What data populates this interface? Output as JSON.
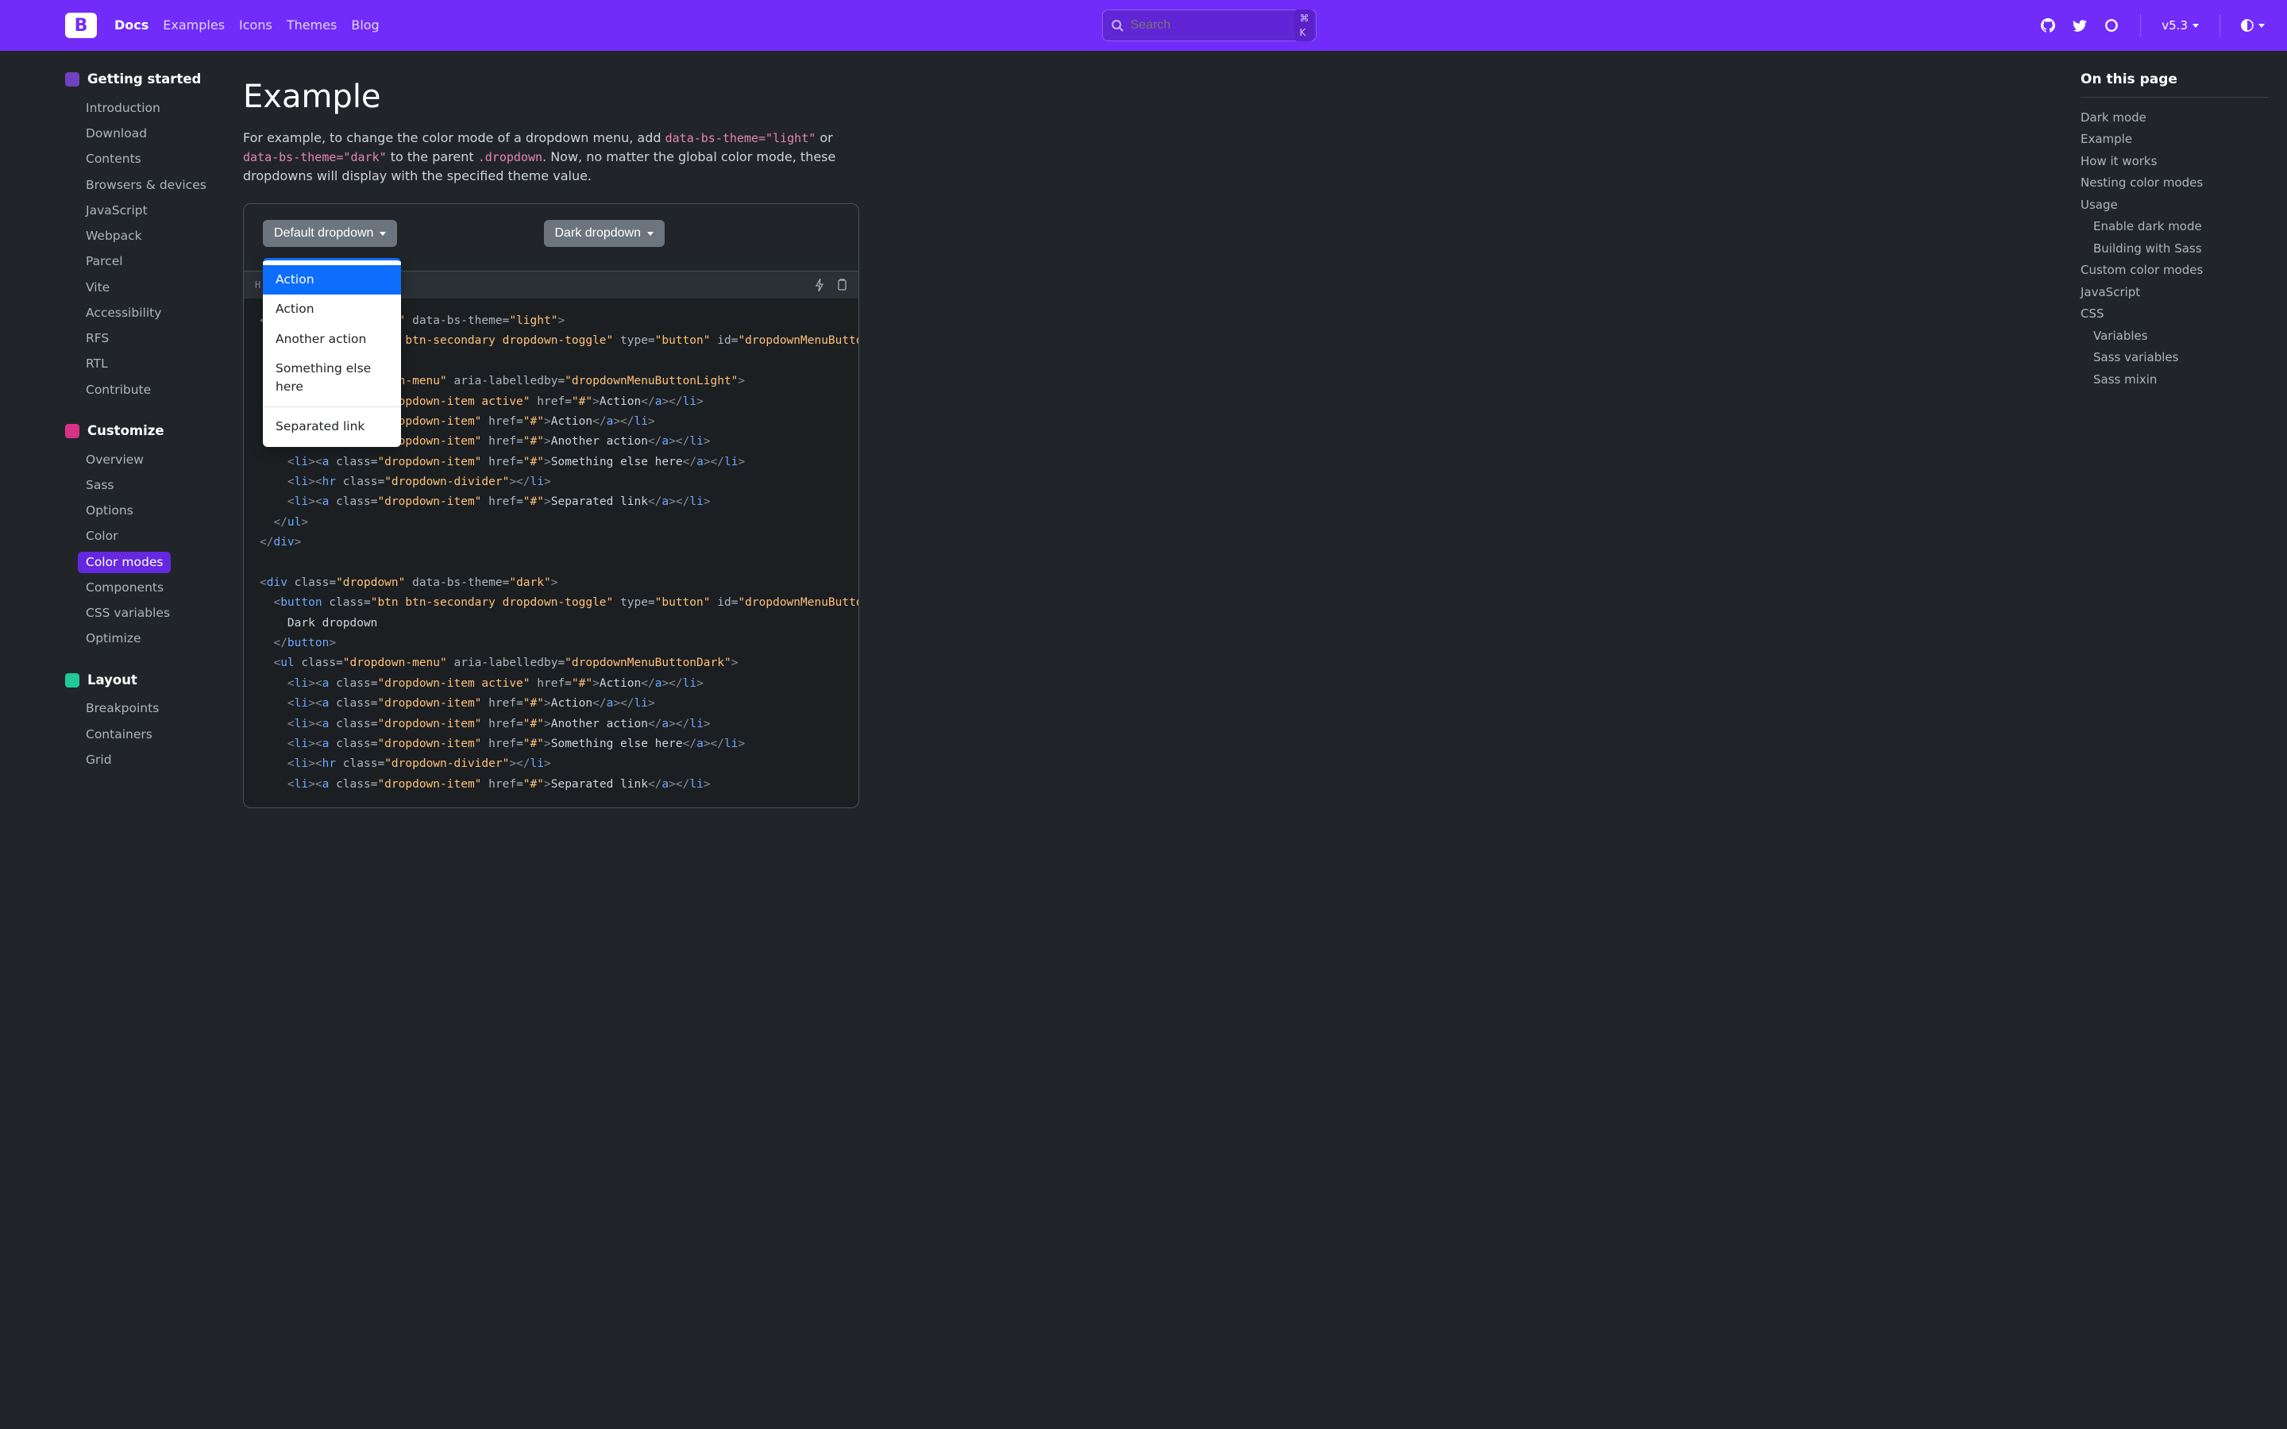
{
  "header": {
    "nav": [
      "Docs",
      "Examples",
      "Icons",
      "Themes",
      "Blog"
    ],
    "nav_active": 0,
    "search_placeholder": "Search",
    "search_kbd": "⌘ K",
    "version": "v5.3"
  },
  "sidebar": {
    "sections": [
      {
        "title": "Getting started",
        "badge": "violet",
        "items": [
          "Introduction",
          "Download",
          "Contents",
          "Browsers & devices",
          "JavaScript",
          "Webpack",
          "Parcel",
          "Vite",
          "Accessibility",
          "RFS",
          "RTL",
          "Contribute"
        ],
        "active": -1
      },
      {
        "title": "Customize",
        "badge": "pink",
        "items": [
          "Overview",
          "Sass",
          "Options",
          "Color",
          "Color modes",
          "Components",
          "CSS variables",
          "Optimize"
        ],
        "active": 4
      },
      {
        "title": "Layout",
        "badge": "teal",
        "items": [
          "Breakpoints",
          "Containers",
          "Grid"
        ],
        "active": -1
      }
    ]
  },
  "main": {
    "title": "Example",
    "lead_pre": "For example, to change the color mode of a dropdown menu, add ",
    "code1": "data-bs-theme=\"light\"",
    "lead_mid": " or ",
    "code2": "data-bs-theme=\"dark\"",
    "lead_mid2": " to the parent ",
    "code3": ".dropdown",
    "lead_post": ". Now, no matter the global color mode, these dropdowns will display with the specified theme value.",
    "btn_default": "Default dropdown",
    "btn_dark": "Dark dropdown",
    "dropdown_items": [
      "Action",
      "Action",
      "Another action",
      "Something else here",
      "Separated link"
    ],
    "code_label": "H"
  },
  "toc": {
    "title": "On this page",
    "items": [
      {
        "label": "Dark mode",
        "sub": false
      },
      {
        "label": "Example",
        "sub": false
      },
      {
        "label": "How it works",
        "sub": false
      },
      {
        "label": "Nesting color modes",
        "sub": false
      },
      {
        "label": "Usage",
        "sub": false
      },
      {
        "label": "Enable dark mode",
        "sub": true
      },
      {
        "label": "Building with Sass",
        "sub": true
      },
      {
        "label": "Custom color modes",
        "sub": false
      },
      {
        "label": "JavaScript",
        "sub": false
      },
      {
        "label": "CSS",
        "sub": false
      },
      {
        "label": "Variables",
        "sub": true
      },
      {
        "label": "Sass variables",
        "sub": true
      },
      {
        "label": "Sass mixin",
        "sub": true
      }
    ]
  },
  "code_lines": [
    [
      {
        "c": "p",
        "t": "<"
      },
      {
        "c": "t",
        "t": "div"
      },
      {
        "c": "p",
        "t": " "
      },
      {
        "c": "an",
        "t": "class"
      },
      {
        "c": "eq",
        "t": "="
      },
      {
        "c": "av",
        "t": "\"dropdown\""
      },
      {
        "c": "p",
        "t": " "
      },
      {
        "c": "an",
        "t": "data-bs-theme"
      },
      {
        "c": "eq",
        "t": "="
      },
      {
        "c": "av",
        "t": "\"light\""
      },
      {
        "c": "p",
        "t": ">"
      }
    ],
    [
      {
        "c": "p",
        "t": "  <"
      },
      {
        "c": "t",
        "t": "button"
      },
      {
        "c": "p",
        "t": " "
      },
      {
        "c": "an",
        "t": "class"
      },
      {
        "c": "eq",
        "t": "="
      },
      {
        "c": "av",
        "t": "\"btn btn-secondary dropdown-toggle\""
      },
      {
        "c": "p",
        "t": " "
      },
      {
        "c": "an",
        "t": "type"
      },
      {
        "c": "eq",
        "t": "="
      },
      {
        "c": "av",
        "t": "\"button\""
      },
      {
        "c": "p",
        "t": " "
      },
      {
        "c": "an",
        "t": "id"
      },
      {
        "c": "eq",
        "t": "="
      },
      {
        "c": "av",
        "t": "\"dropdownMenuButto"
      }
    ],
    [
      {
        "c": "tx",
        "t": " "
      }
    ],
    [
      {
        "c": "p",
        "t": "  <"
      },
      {
        "c": "t",
        "t": "ul"
      },
      {
        "c": "p",
        "t": " "
      },
      {
        "c": "an",
        "t": "class"
      },
      {
        "c": "eq",
        "t": "="
      },
      {
        "c": "av",
        "t": "\"dropdown-menu\""
      },
      {
        "c": "p",
        "t": " "
      },
      {
        "c": "an",
        "t": "aria-labelledby"
      },
      {
        "c": "eq",
        "t": "="
      },
      {
        "c": "av",
        "t": "\"dropdownMenuButtonLight\""
      },
      {
        "c": "p",
        "t": ">"
      }
    ],
    [
      {
        "c": "p",
        "t": "    <"
      },
      {
        "c": "t",
        "t": "li"
      },
      {
        "c": "p",
        "t": "><"
      },
      {
        "c": "t",
        "t": "a"
      },
      {
        "c": "p",
        "t": " "
      },
      {
        "c": "an",
        "t": "class"
      },
      {
        "c": "eq",
        "t": "="
      },
      {
        "c": "av",
        "t": "\"dropdown-item active\""
      },
      {
        "c": "p",
        "t": " "
      },
      {
        "c": "an",
        "t": "href"
      },
      {
        "c": "eq",
        "t": "="
      },
      {
        "c": "av",
        "t": "\"#\""
      },
      {
        "c": "p",
        "t": ">"
      },
      {
        "c": "tx",
        "t": "Action"
      },
      {
        "c": "p",
        "t": "</"
      },
      {
        "c": "t",
        "t": "a"
      },
      {
        "c": "p",
        "t": "></"
      },
      {
        "c": "t",
        "t": "li"
      },
      {
        "c": "p",
        "t": ">"
      }
    ],
    [
      {
        "c": "p",
        "t": "    <"
      },
      {
        "c": "t",
        "t": "li"
      },
      {
        "c": "p",
        "t": "><"
      },
      {
        "c": "t",
        "t": "a"
      },
      {
        "c": "p",
        "t": " "
      },
      {
        "c": "an",
        "t": "class"
      },
      {
        "c": "eq",
        "t": "="
      },
      {
        "c": "av",
        "t": "\"dropdown-item\""
      },
      {
        "c": "p",
        "t": " "
      },
      {
        "c": "an",
        "t": "href"
      },
      {
        "c": "eq",
        "t": "="
      },
      {
        "c": "av",
        "t": "\"#\""
      },
      {
        "c": "p",
        "t": ">"
      },
      {
        "c": "tx",
        "t": "Action"
      },
      {
        "c": "p",
        "t": "</"
      },
      {
        "c": "t",
        "t": "a"
      },
      {
        "c": "p",
        "t": "></"
      },
      {
        "c": "t",
        "t": "li"
      },
      {
        "c": "p",
        "t": ">"
      }
    ],
    [
      {
        "c": "p",
        "t": "    <"
      },
      {
        "c": "t",
        "t": "li"
      },
      {
        "c": "p",
        "t": "><"
      },
      {
        "c": "t",
        "t": "a"
      },
      {
        "c": "p",
        "t": " "
      },
      {
        "c": "an",
        "t": "class"
      },
      {
        "c": "eq",
        "t": "="
      },
      {
        "c": "av",
        "t": "\"dropdown-item\""
      },
      {
        "c": "p",
        "t": " "
      },
      {
        "c": "an",
        "t": "href"
      },
      {
        "c": "eq",
        "t": "="
      },
      {
        "c": "av",
        "t": "\"#\""
      },
      {
        "c": "p",
        "t": ">"
      },
      {
        "c": "tx",
        "t": "Another action"
      },
      {
        "c": "p",
        "t": "</"
      },
      {
        "c": "t",
        "t": "a"
      },
      {
        "c": "p",
        "t": "></"
      },
      {
        "c": "t",
        "t": "li"
      },
      {
        "c": "p",
        "t": ">"
      }
    ],
    [
      {
        "c": "p",
        "t": "    <"
      },
      {
        "c": "t",
        "t": "li"
      },
      {
        "c": "p",
        "t": "><"
      },
      {
        "c": "t",
        "t": "a"
      },
      {
        "c": "p",
        "t": " "
      },
      {
        "c": "an",
        "t": "class"
      },
      {
        "c": "eq",
        "t": "="
      },
      {
        "c": "av",
        "t": "\"dropdown-item\""
      },
      {
        "c": "p",
        "t": " "
      },
      {
        "c": "an",
        "t": "href"
      },
      {
        "c": "eq",
        "t": "="
      },
      {
        "c": "av",
        "t": "\"#\""
      },
      {
        "c": "p",
        "t": ">"
      },
      {
        "c": "tx",
        "t": "Something else here"
      },
      {
        "c": "p",
        "t": "</"
      },
      {
        "c": "t",
        "t": "a"
      },
      {
        "c": "p",
        "t": "></"
      },
      {
        "c": "t",
        "t": "li"
      },
      {
        "c": "p",
        "t": ">"
      }
    ],
    [
      {
        "c": "p",
        "t": "    <"
      },
      {
        "c": "t",
        "t": "li"
      },
      {
        "c": "p",
        "t": "><"
      },
      {
        "c": "t",
        "t": "hr"
      },
      {
        "c": "p",
        "t": " "
      },
      {
        "c": "an",
        "t": "class"
      },
      {
        "c": "eq",
        "t": "="
      },
      {
        "c": "av",
        "t": "\"dropdown-divider\""
      },
      {
        "c": "p",
        "t": "></"
      },
      {
        "c": "t",
        "t": "li"
      },
      {
        "c": "p",
        "t": ">"
      }
    ],
    [
      {
        "c": "p",
        "t": "    <"
      },
      {
        "c": "t",
        "t": "li"
      },
      {
        "c": "p",
        "t": "><"
      },
      {
        "c": "t",
        "t": "a"
      },
      {
        "c": "p",
        "t": " "
      },
      {
        "c": "an",
        "t": "class"
      },
      {
        "c": "eq",
        "t": "="
      },
      {
        "c": "av",
        "t": "\"dropdown-item\""
      },
      {
        "c": "p",
        "t": " "
      },
      {
        "c": "an",
        "t": "href"
      },
      {
        "c": "eq",
        "t": "="
      },
      {
        "c": "av",
        "t": "\"#\""
      },
      {
        "c": "p",
        "t": ">"
      },
      {
        "c": "tx",
        "t": "Separated link"
      },
      {
        "c": "p",
        "t": "</"
      },
      {
        "c": "t",
        "t": "a"
      },
      {
        "c": "p",
        "t": "></"
      },
      {
        "c": "t",
        "t": "li"
      },
      {
        "c": "p",
        "t": ">"
      }
    ],
    [
      {
        "c": "p",
        "t": "  </"
      },
      {
        "c": "t",
        "t": "ul"
      },
      {
        "c": "p",
        "t": ">"
      }
    ],
    [
      {
        "c": "p",
        "t": "</"
      },
      {
        "c": "t",
        "t": "div"
      },
      {
        "c": "p",
        "t": ">"
      }
    ],
    [
      {
        "c": "tx",
        "t": ""
      }
    ],
    [
      {
        "c": "p",
        "t": "<"
      },
      {
        "c": "t",
        "t": "div"
      },
      {
        "c": "p",
        "t": " "
      },
      {
        "c": "an",
        "t": "class"
      },
      {
        "c": "eq",
        "t": "="
      },
      {
        "c": "av",
        "t": "\"dropdown\""
      },
      {
        "c": "p",
        "t": " "
      },
      {
        "c": "an",
        "t": "data-bs-theme"
      },
      {
        "c": "eq",
        "t": "="
      },
      {
        "c": "av",
        "t": "\"dark\""
      },
      {
        "c": "p",
        "t": ">"
      }
    ],
    [
      {
        "c": "p",
        "t": "  <"
      },
      {
        "c": "t",
        "t": "button"
      },
      {
        "c": "p",
        "t": " "
      },
      {
        "c": "an",
        "t": "class"
      },
      {
        "c": "eq",
        "t": "="
      },
      {
        "c": "av",
        "t": "\"btn btn-secondary dropdown-toggle\""
      },
      {
        "c": "p",
        "t": " "
      },
      {
        "c": "an",
        "t": "type"
      },
      {
        "c": "eq",
        "t": "="
      },
      {
        "c": "av",
        "t": "\"button\""
      },
      {
        "c": "p",
        "t": " "
      },
      {
        "c": "an",
        "t": "id"
      },
      {
        "c": "eq",
        "t": "="
      },
      {
        "c": "av",
        "t": "\"dropdownMenuButto"
      }
    ],
    [
      {
        "c": "tx",
        "t": "    Dark dropdown"
      }
    ],
    [
      {
        "c": "p",
        "t": "  </"
      },
      {
        "c": "t",
        "t": "button"
      },
      {
        "c": "p",
        "t": ">"
      }
    ],
    [
      {
        "c": "p",
        "t": "  <"
      },
      {
        "c": "t",
        "t": "ul"
      },
      {
        "c": "p",
        "t": " "
      },
      {
        "c": "an",
        "t": "class"
      },
      {
        "c": "eq",
        "t": "="
      },
      {
        "c": "av",
        "t": "\"dropdown-menu\""
      },
      {
        "c": "p",
        "t": " "
      },
      {
        "c": "an",
        "t": "aria-labelledby"
      },
      {
        "c": "eq",
        "t": "="
      },
      {
        "c": "av",
        "t": "\"dropdownMenuButtonDark\""
      },
      {
        "c": "p",
        "t": ">"
      }
    ],
    [
      {
        "c": "p",
        "t": "    <"
      },
      {
        "c": "t",
        "t": "li"
      },
      {
        "c": "p",
        "t": "><"
      },
      {
        "c": "t",
        "t": "a"
      },
      {
        "c": "p",
        "t": " "
      },
      {
        "c": "an",
        "t": "class"
      },
      {
        "c": "eq",
        "t": "="
      },
      {
        "c": "av",
        "t": "\"dropdown-item active\""
      },
      {
        "c": "p",
        "t": " "
      },
      {
        "c": "an",
        "t": "href"
      },
      {
        "c": "eq",
        "t": "="
      },
      {
        "c": "av",
        "t": "\"#\""
      },
      {
        "c": "p",
        "t": ">"
      },
      {
        "c": "tx",
        "t": "Action"
      },
      {
        "c": "p",
        "t": "</"
      },
      {
        "c": "t",
        "t": "a"
      },
      {
        "c": "p",
        "t": "></"
      },
      {
        "c": "t",
        "t": "li"
      },
      {
        "c": "p",
        "t": ">"
      }
    ],
    [
      {
        "c": "p",
        "t": "    <"
      },
      {
        "c": "t",
        "t": "li"
      },
      {
        "c": "p",
        "t": "><"
      },
      {
        "c": "t",
        "t": "a"
      },
      {
        "c": "p",
        "t": " "
      },
      {
        "c": "an",
        "t": "class"
      },
      {
        "c": "eq",
        "t": "="
      },
      {
        "c": "av",
        "t": "\"dropdown-item\""
      },
      {
        "c": "p",
        "t": " "
      },
      {
        "c": "an",
        "t": "href"
      },
      {
        "c": "eq",
        "t": "="
      },
      {
        "c": "av",
        "t": "\"#\""
      },
      {
        "c": "p",
        "t": ">"
      },
      {
        "c": "tx",
        "t": "Action"
      },
      {
        "c": "p",
        "t": "</"
      },
      {
        "c": "t",
        "t": "a"
      },
      {
        "c": "p",
        "t": "></"
      },
      {
        "c": "t",
        "t": "li"
      },
      {
        "c": "p",
        "t": ">"
      }
    ],
    [
      {
        "c": "p",
        "t": "    <"
      },
      {
        "c": "t",
        "t": "li"
      },
      {
        "c": "p",
        "t": "><"
      },
      {
        "c": "t",
        "t": "a"
      },
      {
        "c": "p",
        "t": " "
      },
      {
        "c": "an",
        "t": "class"
      },
      {
        "c": "eq",
        "t": "="
      },
      {
        "c": "av",
        "t": "\"dropdown-item\""
      },
      {
        "c": "p",
        "t": " "
      },
      {
        "c": "an",
        "t": "href"
      },
      {
        "c": "eq",
        "t": "="
      },
      {
        "c": "av",
        "t": "\"#\""
      },
      {
        "c": "p",
        "t": ">"
      },
      {
        "c": "tx",
        "t": "Another action"
      },
      {
        "c": "p",
        "t": "</"
      },
      {
        "c": "t",
        "t": "a"
      },
      {
        "c": "p",
        "t": "></"
      },
      {
        "c": "t",
        "t": "li"
      },
      {
        "c": "p",
        "t": ">"
      }
    ],
    [
      {
        "c": "p",
        "t": "    <"
      },
      {
        "c": "t",
        "t": "li"
      },
      {
        "c": "p",
        "t": "><"
      },
      {
        "c": "t",
        "t": "a"
      },
      {
        "c": "p",
        "t": " "
      },
      {
        "c": "an",
        "t": "class"
      },
      {
        "c": "eq",
        "t": "="
      },
      {
        "c": "av",
        "t": "\"dropdown-item\""
      },
      {
        "c": "p",
        "t": " "
      },
      {
        "c": "an",
        "t": "href"
      },
      {
        "c": "eq",
        "t": "="
      },
      {
        "c": "av",
        "t": "\"#\""
      },
      {
        "c": "p",
        "t": ">"
      },
      {
        "c": "tx",
        "t": "Something else here"
      },
      {
        "c": "p",
        "t": "</"
      },
      {
        "c": "t",
        "t": "a"
      },
      {
        "c": "p",
        "t": "></"
      },
      {
        "c": "t",
        "t": "li"
      },
      {
        "c": "p",
        "t": ">"
      }
    ],
    [
      {
        "c": "p",
        "t": "    <"
      },
      {
        "c": "t",
        "t": "li"
      },
      {
        "c": "p",
        "t": "><"
      },
      {
        "c": "t",
        "t": "hr"
      },
      {
        "c": "p",
        "t": " "
      },
      {
        "c": "an",
        "t": "class"
      },
      {
        "c": "eq",
        "t": "="
      },
      {
        "c": "av",
        "t": "\"dropdown-divider\""
      },
      {
        "c": "p",
        "t": "></"
      },
      {
        "c": "t",
        "t": "li"
      },
      {
        "c": "p",
        "t": ">"
      }
    ],
    [
      {
        "c": "p",
        "t": "    <"
      },
      {
        "c": "t",
        "t": "li"
      },
      {
        "c": "p",
        "t": "><"
      },
      {
        "c": "t",
        "t": "a"
      },
      {
        "c": "p",
        "t": " "
      },
      {
        "c": "an",
        "t": "class"
      },
      {
        "c": "eq",
        "t": "="
      },
      {
        "c": "av",
        "t": "\"dropdown-item\""
      },
      {
        "c": "p",
        "t": " "
      },
      {
        "c": "an",
        "t": "href"
      },
      {
        "c": "eq",
        "t": "="
      },
      {
        "c": "av",
        "t": "\"#\""
      },
      {
        "c": "p",
        "t": ">"
      },
      {
        "c": "tx",
        "t": "Separated link"
      },
      {
        "c": "p",
        "t": "</"
      },
      {
        "c": "t",
        "t": "a"
      },
      {
        "c": "p",
        "t": "></"
      },
      {
        "c": "t",
        "t": "li"
      },
      {
        "c": "p",
        "t": ">"
      }
    ]
  ]
}
